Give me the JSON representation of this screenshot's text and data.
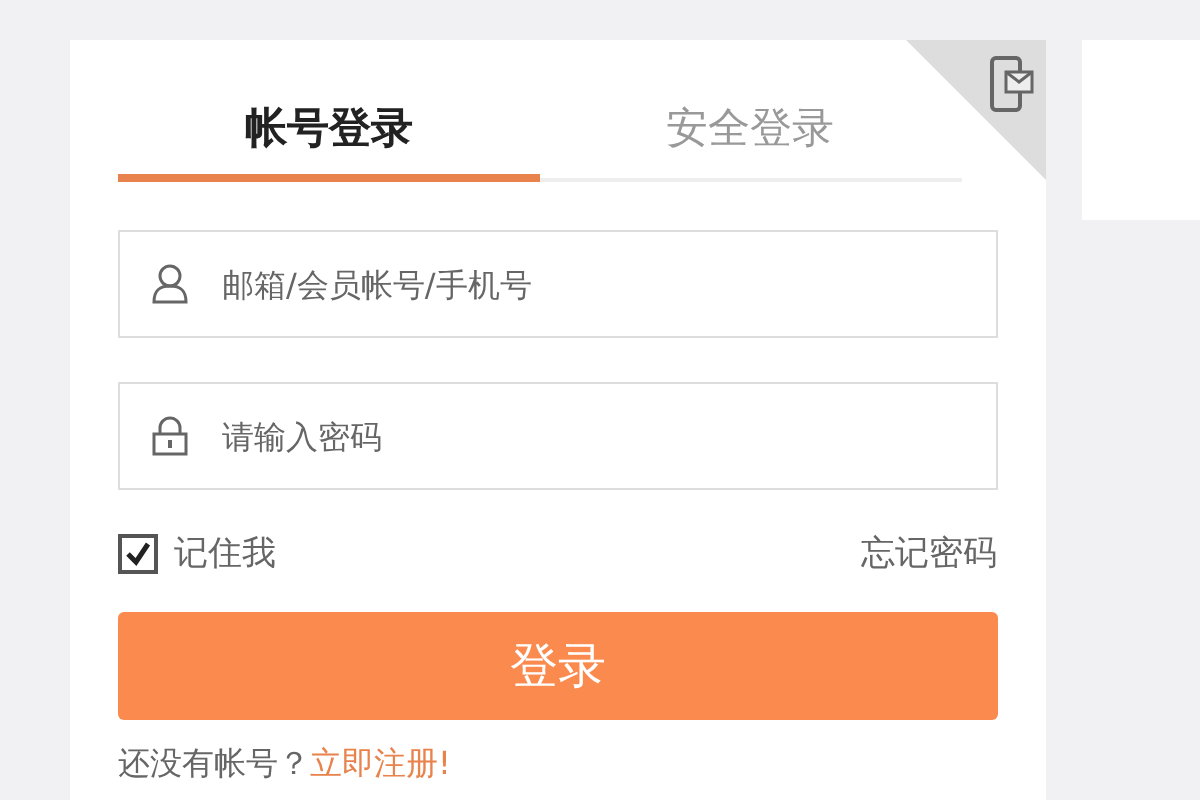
{
  "tabs": [
    {
      "label": "帐号登录",
      "selected": true
    },
    {
      "label": "安全登录",
      "selected": false
    }
  ],
  "fields": [
    {
      "kind": "user",
      "placeholder": "邮箱/会员帐号/手机号"
    },
    {
      "kind": "lock",
      "placeholder": "请输入密码"
    }
  ],
  "remember": {
    "label": "记住我",
    "checked": true
  },
  "forgot_link": "忘记密码",
  "login_button": "登录",
  "footer": {
    "text": "还没有帐号？",
    "link": "立即注册!"
  }
}
